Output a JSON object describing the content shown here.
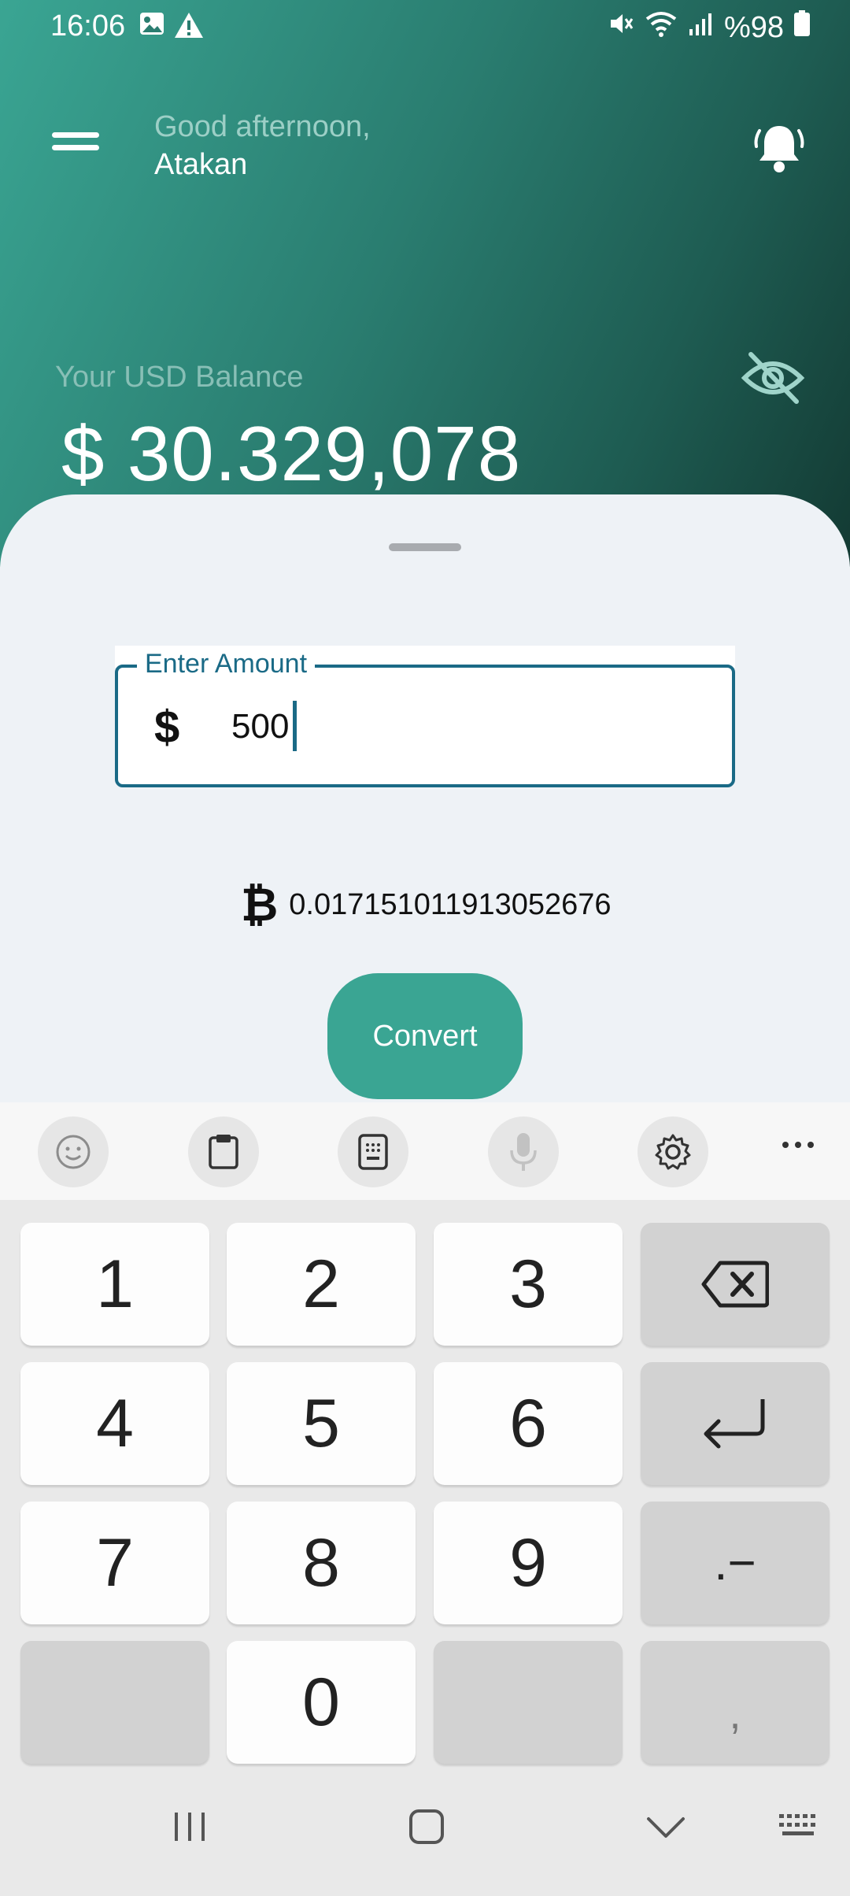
{
  "status_bar": {
    "time": "16:06",
    "battery": "%98"
  },
  "header": {
    "greeting": "Good afternoon,",
    "username": "Atakan",
    "balance_label": "Your USD Balance",
    "balance_value": "$ 30.329,078"
  },
  "converter": {
    "field_label": "Enter Amount",
    "currency_symbol": "$",
    "amount": "500",
    "btc_symbol": "₿",
    "btc_result": "0.017151011913052676",
    "convert_label": "Convert"
  },
  "keyboard": {
    "toolbar_icons": [
      "emoji-icon",
      "clipboard-icon",
      "keypad-icon",
      "microphone-icon",
      "settings-icon",
      "more-icon"
    ],
    "keys": [
      "1",
      "2",
      "3",
      "4",
      "5",
      "6",
      "7",
      "8",
      "9",
      "0"
    ],
    "symbol_key": ".−",
    "comma_key": ","
  },
  "colors": {
    "accent": "#3aa593",
    "field_border": "#1a6a86",
    "header_dark": "#133a33"
  }
}
